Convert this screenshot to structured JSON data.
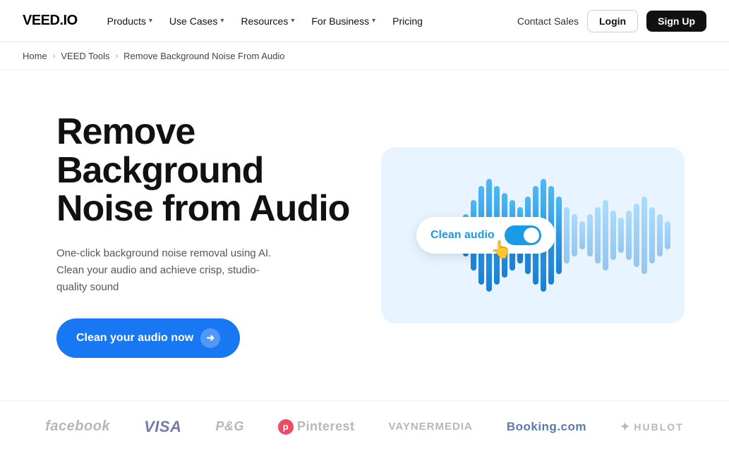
{
  "brand": {
    "logo": "VEED.IO"
  },
  "nav": {
    "items": [
      {
        "label": "Products",
        "hasChevron": true
      },
      {
        "label": "Use Cases",
        "hasChevron": true
      },
      {
        "label": "Resources",
        "hasChevron": true
      },
      {
        "label": "For Business",
        "hasChevron": true
      },
      {
        "label": "Pricing",
        "hasChevron": false
      }
    ],
    "contact_sales": "Contact Sales",
    "login": "Login",
    "signup": "Sign Up"
  },
  "breadcrumb": {
    "home": "Home",
    "veed_tools": "VEED Tools",
    "current": "Remove Background Noise From Audio"
  },
  "hero": {
    "title": "Remove Background Noise from Audio",
    "description": "One-click background noise removal using AI. Clean your audio and achieve crisp, studio-quality sound",
    "cta_label": "Clean your audio now",
    "toggle_label": "Clean audio"
  },
  "waveform": {
    "bars": [
      20,
      60,
      100,
      140,
      160,
      140,
      120,
      100,
      80,
      110,
      140,
      160,
      140,
      110,
      80,
      60,
      40,
      60,
      80,
      100,
      70,
      50,
      70,
      90,
      110,
      80,
      60,
      40
    ]
  },
  "brands": [
    {
      "name": "facebook",
      "class": "brand-facebook"
    },
    {
      "name": "VISA",
      "class": "brand-visa"
    },
    {
      "name": "P&G",
      "class": "brand-pg"
    },
    {
      "name": "Pinterest",
      "class": "brand-pinterest"
    },
    {
      "name": "VAYNERMEDIA",
      "class": "brand-vaynermedia"
    },
    {
      "name": "Booking.com",
      "class": "brand-booking"
    },
    {
      "name": "HUBLOT",
      "class": "brand-hublot"
    }
  ]
}
